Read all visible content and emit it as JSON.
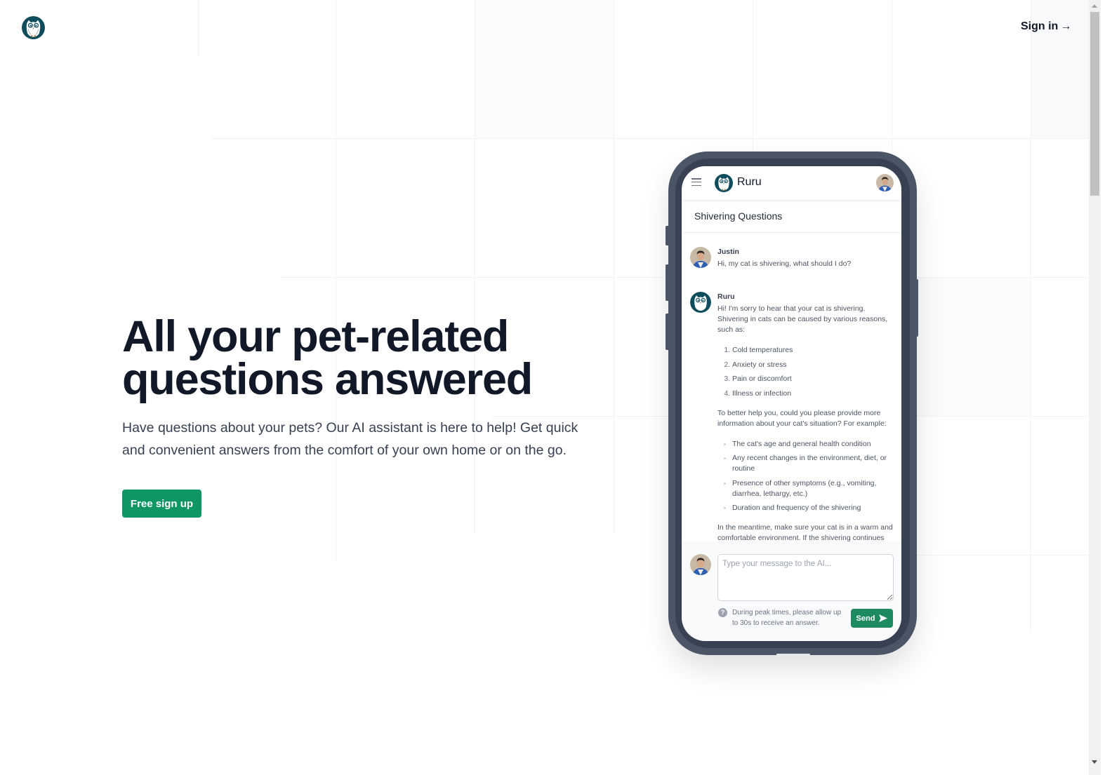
{
  "header": {
    "logo_icon": "owl-logo-icon",
    "signin_label": "Sign in",
    "signin_arrow": "→"
  },
  "hero": {
    "title_line1": "All your pet-related",
    "title_line2": "questions answered",
    "subtitle": "Have questions about your pets? Our AI assistant is here to help! Get quick and convenient answers from the comfort of your own home or on the go.",
    "cta_label": "Free sign up"
  },
  "colors": {
    "brand_green": "#0e9765",
    "send_green": "#1e8a5f",
    "owl_teal": "#0f4c5c",
    "phone_frame": "#4a5565",
    "text_dark": "#111827"
  },
  "phone": {
    "app_name": "Ruru",
    "menu_icon": "hamburger-menu-icon",
    "conversation_title": "Shivering Questions",
    "messages": [
      {
        "author": "Justin",
        "text": "Hi, my cat is shivering, what should I do?"
      },
      {
        "author": "Ruru",
        "intro": "Hi! I'm sorry to hear that your cat is shivering. Shivering in cats can be caused by various reasons, such as:",
        "reasons": [
          "Cold temperatures",
          "Anxiety or stress",
          "Pain or discomfort",
          "Illness or infection"
        ],
        "followup": "To better help you, could you please provide more information about your cat's situation? For example:",
        "details": [
          "The cat's age and general health condition",
          "Any recent changes in the environment, diet, or routine",
          "Presence of other symptoms (e.g., vomiting, diarrhea, lethargy, etc.)",
          "Duration and frequency of the shivering"
        ],
        "closing": "In the meantime, make sure your cat is in a warm and comfortable environment. If the shivering continues"
      }
    ],
    "composer": {
      "placeholder": "Type your message to the AI...",
      "value": "",
      "help_icon": "?",
      "help_text": "During peak times, please allow up to 30s to receive an answer.",
      "send_label": "Send"
    }
  }
}
